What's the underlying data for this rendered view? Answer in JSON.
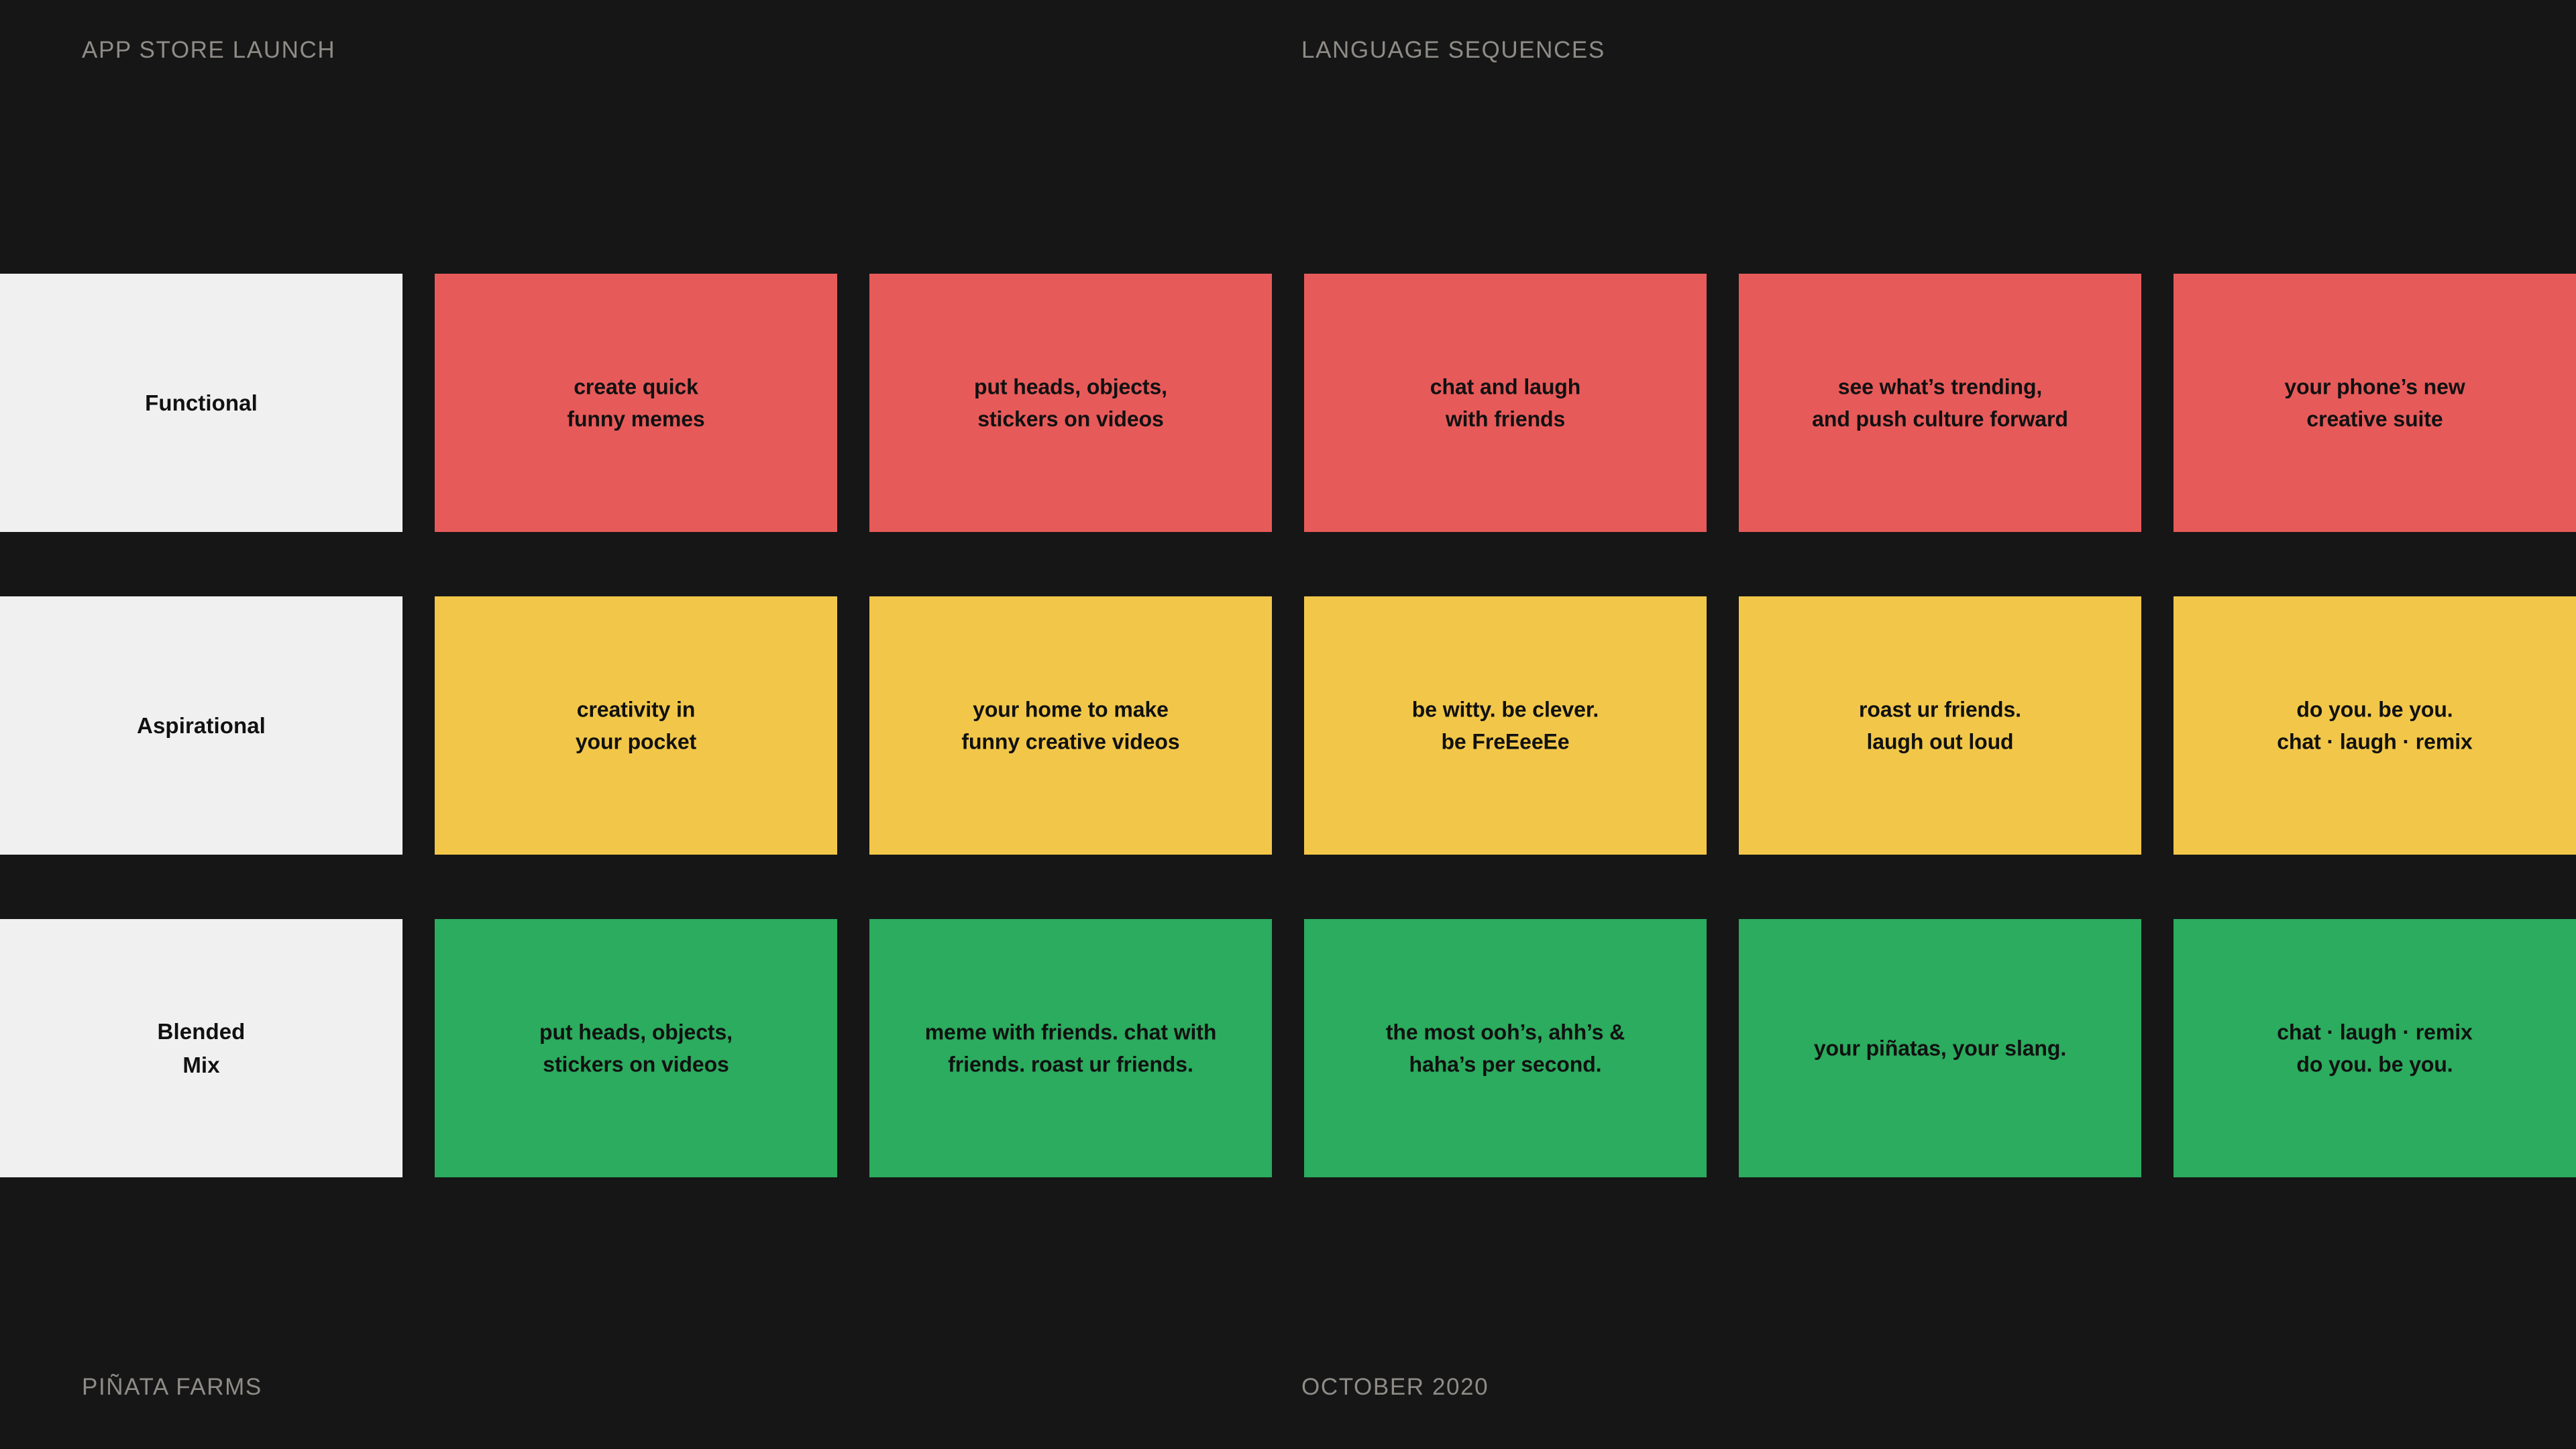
{
  "header": {
    "left_label": "APP STORE LAUNCH",
    "center_label": "LANGUAGE SEQUENCES"
  },
  "footer": {
    "left_label": "PIÑATA FARMS",
    "center_label": "OCTOBER 2020"
  },
  "colors": {
    "background": "#161617",
    "label_card": "#f0f0f0",
    "row_functional": "#e75a5a",
    "row_aspirational": "#f2c749",
    "row_blended": "#2bac5e",
    "text_dark": "#111111",
    "text_muted": "#8f8c87"
  },
  "rows": [
    {
      "label": "Functional",
      "color": "#e75a5a",
      "cards": [
        "create quick\nfunny memes",
        "put heads, objects,\nstickers on videos",
        "chat and laugh\nwith friends",
        "see what’s trending,\nand push culture forward",
        "your phone’s new\ncreative suite"
      ]
    },
    {
      "label": "Aspirational",
      "color": "#f2c749",
      "cards": [
        "creativity in\nyour pocket",
        "your home to make\nfunny creative videos",
        "be witty. be clever.\nbe FreEeeEe",
        "roast ur friends.\nlaugh out loud",
        "do you. be you.\nchat · laugh · remix"
      ]
    },
    {
      "label": "Blended\nMix",
      "color": "#2bac5e",
      "cards": [
        "put heads, objects,\nstickers on videos",
        "meme with friends. chat with\nfriends. roast ur friends.",
        "the most ooh’s, ahh’s &\nhaha’s per second.",
        "your piñatas, your slang.",
        "chat · laugh · remix\ndo you. be you."
      ]
    }
  ]
}
